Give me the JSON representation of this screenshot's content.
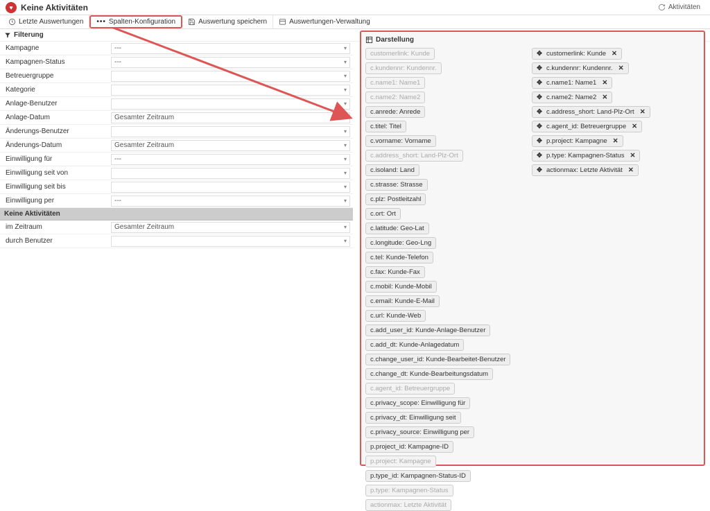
{
  "header": {
    "title": "Keine Aktivitäten",
    "refresh": "Aktivitäten"
  },
  "toolbar": [
    "Letzte Auswertungen",
    "Spalten-Konfiguration",
    "Auswertung speichern",
    "Auswertungen-Verwaltung"
  ],
  "filter": {
    "title": "Filterung",
    "rows": [
      {
        "label": "Kampagne",
        "value": "---"
      },
      {
        "label": "Kampagnen-Status",
        "value": "---"
      },
      {
        "label": "Betreuergruppe",
        "value": ""
      },
      {
        "label": "Kategorie",
        "value": ""
      },
      {
        "label": "Anlage-Benutzer",
        "value": ""
      },
      {
        "label": "Anlage-Datum",
        "value": "Gesamter Zeitraum"
      },
      {
        "label": "Änderungs-Benutzer",
        "value": ""
      },
      {
        "label": "Änderungs-Datum",
        "value": "Gesamter Zeitraum"
      },
      {
        "label": "Einwilligung für",
        "value": "---"
      },
      {
        "label": "Einwilligung seit von",
        "value": ""
      },
      {
        "label": "Einwilligung seit bis",
        "value": ""
      },
      {
        "label": "Einwilligung per",
        "value": "---"
      }
    ],
    "section": "Keine Aktivitäten",
    "rows2": [
      {
        "label": "im Zeitraum",
        "value": "Gesamter Zeitraum"
      },
      {
        "label": "durch Benutzer",
        "value": ""
      }
    ]
  },
  "darstellung": {
    "title": "Darstellung",
    "available": [
      {
        "label": "customerlink: Kunde",
        "disabled": true
      },
      {
        "label": "c.kundennr: Kundennr.",
        "disabled": true
      },
      {
        "label": "c.name1: Name1",
        "disabled": true
      },
      {
        "label": "c.name2: Name2",
        "disabled": true
      },
      {
        "label": "c.anrede: Anrede",
        "disabled": false
      },
      {
        "label": "c.titel: Titel",
        "disabled": false
      },
      {
        "label": "c.vorname: Vorname",
        "disabled": false
      },
      {
        "label": "c.address_short: Land-Plz-Ort",
        "disabled": true
      },
      {
        "label": "c.isoland: Land",
        "disabled": false
      },
      {
        "label": "c.strasse: Strasse",
        "disabled": false
      },
      {
        "label": "c.plz: Postleitzahl",
        "disabled": false
      },
      {
        "label": "c.ort: Ort",
        "disabled": false
      },
      {
        "label": "c.latitude: Geo-Lat",
        "disabled": false
      },
      {
        "label": "c.longitude: Geo-Lng",
        "disabled": false
      },
      {
        "label": "c.tel: Kunde-Telefon",
        "disabled": false
      },
      {
        "label": "c.fax: Kunde-Fax",
        "disabled": false
      },
      {
        "label": "c.mobil: Kunde-Mobil",
        "disabled": false
      },
      {
        "label": "c.email: Kunde-E-Mail",
        "disabled": false
      },
      {
        "label": "c.url: Kunde-Web",
        "disabled": false
      },
      {
        "label": "c.add_user_id: Kunde-Anlage-Benutzer",
        "disabled": false
      },
      {
        "label": "c.add_dt: Kunde-Anlagedatum",
        "disabled": false
      },
      {
        "label": "c.change_user_id: Kunde-Bearbeitet-Benutzer",
        "disabled": false
      },
      {
        "label": "c.change_dt: Kunde-Bearbeitungsdatum",
        "disabled": false
      },
      {
        "label": "c.agent_id: Betreuergruppe",
        "disabled": true
      },
      {
        "label": "c.privacy_scope: Einwilligung für",
        "disabled": false
      },
      {
        "label": "c.privacy_dt: Einwilligung seit",
        "disabled": false
      },
      {
        "label": "c.privacy_source: Einwilligung per",
        "disabled": false
      },
      {
        "label": "p.project_id: Kampagne-ID",
        "disabled": false
      },
      {
        "label": "p.project: Kampagne",
        "disabled": true
      },
      {
        "label": "p.type_id: Kampagnen-Status-ID",
        "disabled": false
      },
      {
        "label": "p.type: Kampagnen-Status",
        "disabled": true
      },
      {
        "label": "actionmax: Letzte Aktivität",
        "disabled": true
      }
    ],
    "selected": [
      "customerlink: Kunde",
      "c.kundennr: Kundennr.",
      "c.name1: Name1",
      "c.name2: Name2",
      "c.address_short: Land-Plz-Ort",
      "c.agent_id: Betreuergruppe",
      "p.project: Kampagne",
      "p.type: Kampagnen-Status",
      "actionmax: Letzte Aktivität"
    ]
  }
}
